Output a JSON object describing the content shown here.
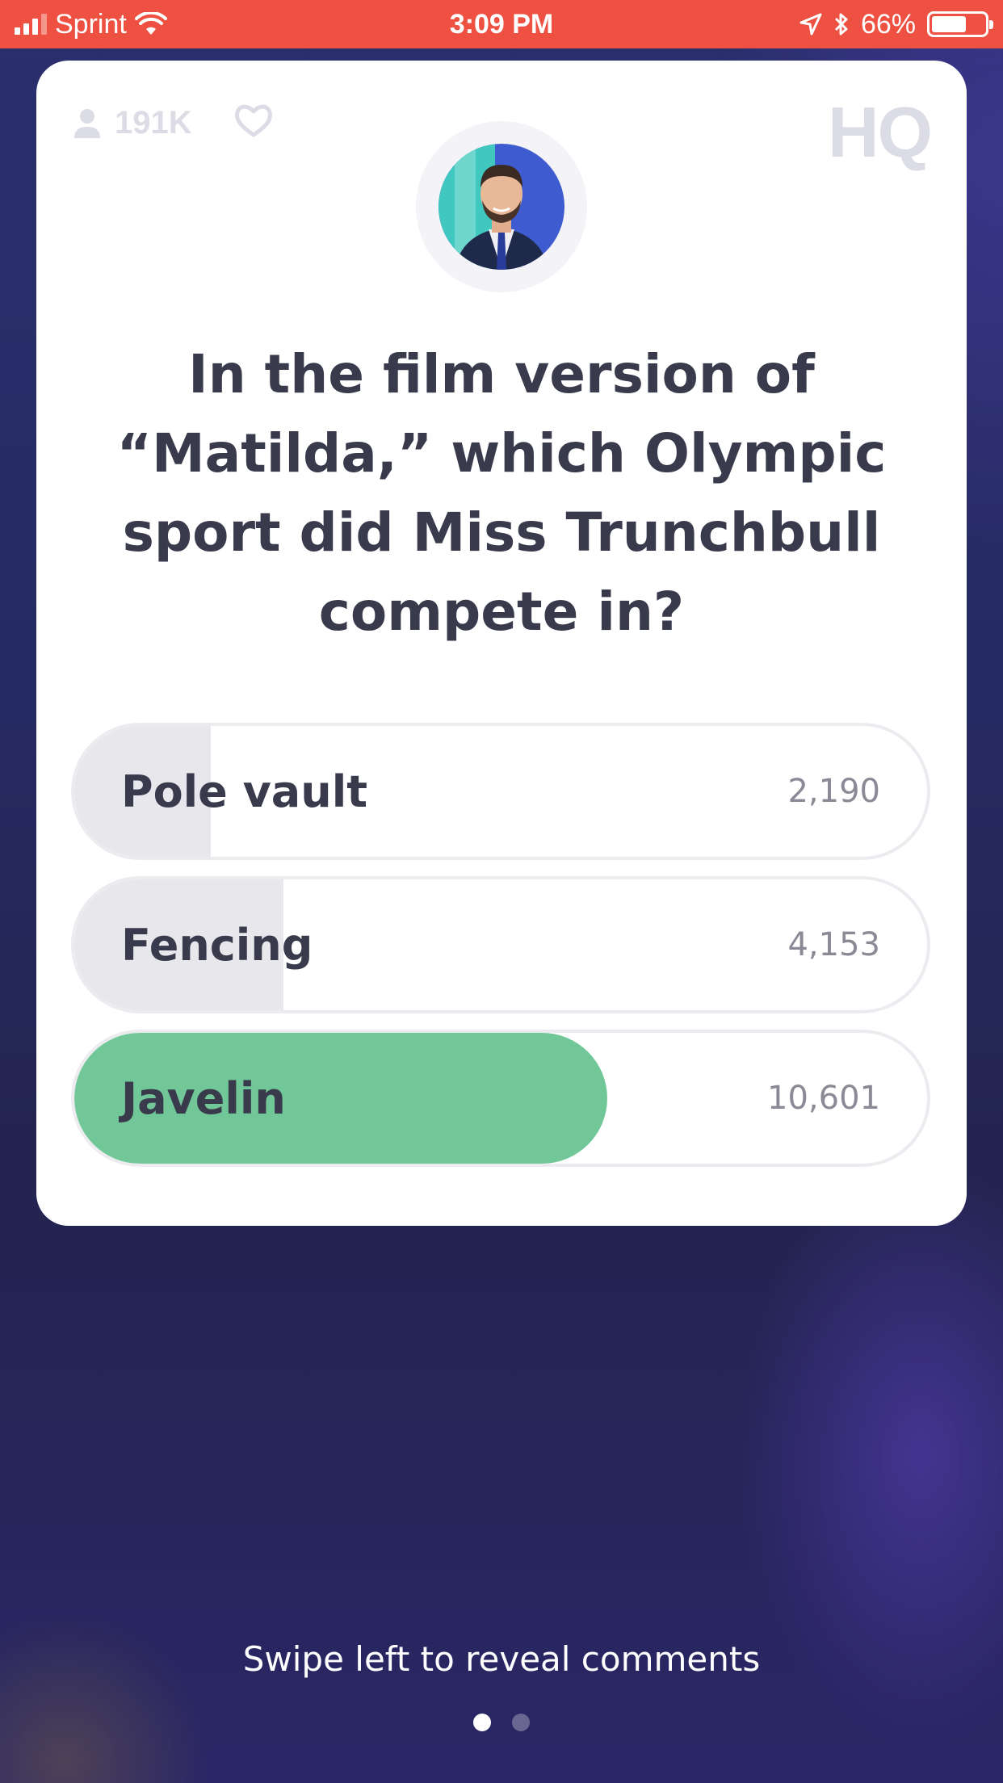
{
  "status_bar": {
    "carrier": "Sprint",
    "time": "3:09 PM",
    "battery_percent": "66%",
    "battery_level": 0.66,
    "icons": [
      "signal-icon",
      "wifi-icon",
      "location-arrow-icon",
      "bluetooth-icon",
      "battery-icon"
    ]
  },
  "card": {
    "viewer_count": "191K",
    "logo": "HQ",
    "question": "In the film version of “Matilda,” which Olympic sport did Miss Trunchbull compete in?",
    "answers": [
      {
        "label": "Pole vault",
        "count": "2,190",
        "fill_fraction": 0.16,
        "correct": false
      },
      {
        "label": "Fencing",
        "count": "4,153",
        "fill_fraction": 0.245,
        "correct": false
      },
      {
        "label": "Javelin",
        "count": "10,601",
        "fill_fraction": 0.625,
        "correct": true
      }
    ],
    "colors": {
      "correct": "#71c797",
      "fill": "#e7e7ec",
      "text": "#3a3a4d"
    }
  },
  "footer": {
    "swipe_hint": "Swipe left to reveal comments",
    "pages": 2,
    "active_page": 1
  }
}
